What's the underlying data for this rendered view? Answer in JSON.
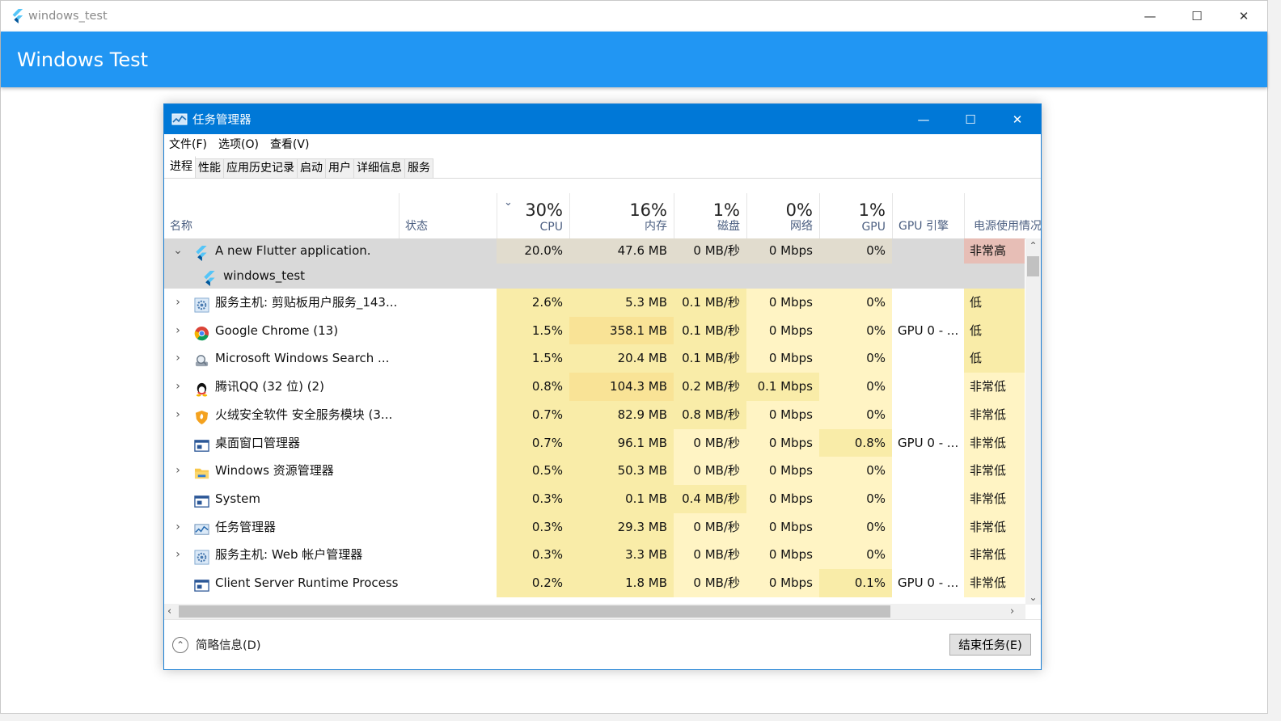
{
  "window": {
    "title": "windows_test",
    "controls": [
      "—",
      "☐",
      "✕"
    ]
  },
  "appbar": {
    "title": "Windows Test"
  },
  "taskmanager": {
    "title": "任务管理器",
    "controls": [
      "—",
      "☐",
      "✕"
    ],
    "menu": [
      "文件(F)",
      "选项(O)",
      "查看(V)"
    ],
    "tabs": [
      "进程",
      "性能",
      "应用历史记录",
      "启动",
      "用户",
      "详细信息",
      "服务"
    ],
    "header": {
      "name": "名称",
      "status": "状态",
      "cpu_pct": "30%",
      "cpu": "CPU",
      "mem_pct": "16%",
      "mem": "内存",
      "disk_pct": "1%",
      "disk": "磁盘",
      "net_pct": "0%",
      "net": "网络",
      "gpu_pct": "1%",
      "gpu": "GPU",
      "gpu_engine": "GPU 引擎",
      "power": "电源使用情况"
    },
    "rows": [
      {
        "name": "A new Flutter application.",
        "cpu": "20.0%",
        "mem": "47.6 MB",
        "disk": "0 MB/秒",
        "net": "0 Mbps",
        "gpu": "0%",
        "engine": "",
        "power": "非常高",
        "chevron": "⌄",
        "icon": "flutter-icon"
      },
      {
        "name": "windows_test",
        "cpu": "",
        "mem": "",
        "disk": "",
        "net": "",
        "gpu": "",
        "engine": "",
        "power": "",
        "chevron": "",
        "icon": "flutter-icon"
      },
      {
        "name": "服务主机: 剪贴板用户服务_143...",
        "cpu": "2.6%",
        "mem": "5.3 MB",
        "disk": "0.1 MB/秒",
        "net": "0 Mbps",
        "gpu": "0%",
        "engine": "",
        "power": "低",
        "chevron": "›",
        "icon": "gear-icon"
      },
      {
        "name": "Google Chrome (13)",
        "cpu": "1.5%",
        "mem": "358.1 MB",
        "disk": "0.1 MB/秒",
        "net": "0 Mbps",
        "gpu": "0%",
        "engine": "GPU 0 - ...",
        "power": "低",
        "chevron": "›",
        "icon": "chrome-icon"
      },
      {
        "name": "Microsoft Windows Search ...",
        "cpu": "1.5%",
        "mem": "20.4 MB",
        "disk": "0.1 MB/秒",
        "net": "0 Mbps",
        "gpu": "0%",
        "engine": "",
        "power": "低",
        "chevron": "›",
        "icon": "search-service-icon"
      },
      {
        "name": "腾讯QQ (32 位) (2)",
        "cpu": "0.8%",
        "mem": "104.3 MB",
        "disk": "0.2 MB/秒",
        "net": "0.1 Mbps",
        "gpu": "0%",
        "engine": "",
        "power": "非常低",
        "chevron": "›",
        "icon": "qq-icon"
      },
      {
        "name": "火绒安全软件 安全服务模块 (3...",
        "cpu": "0.7%",
        "mem": "82.9 MB",
        "disk": "0.8 MB/秒",
        "net": "0 Mbps",
        "gpu": "0%",
        "engine": "",
        "power": "非常低",
        "chevron": "›",
        "icon": "shield-icon"
      },
      {
        "name": "桌面窗口管理器",
        "cpu": "0.7%",
        "mem": "96.1 MB",
        "disk": "0 MB/秒",
        "net": "0 Mbps",
        "gpu": "0.8%",
        "engine": "GPU 0 - ...",
        "power": "非常低",
        "chevron": "",
        "icon": "window-icon"
      },
      {
        "name": "Windows 资源管理器",
        "cpu": "0.5%",
        "mem": "50.3 MB",
        "disk": "0 MB/秒",
        "net": "0 Mbps",
        "gpu": "0%",
        "engine": "",
        "power": "非常低",
        "chevron": "›",
        "icon": "folder-icon"
      },
      {
        "name": "System",
        "cpu": "0.3%",
        "mem": "0.1 MB",
        "disk": "0.4 MB/秒",
        "net": "0 Mbps",
        "gpu": "0%",
        "engine": "",
        "power": "非常低",
        "chevron": "",
        "icon": "window-icon"
      },
      {
        "name": "任务管理器",
        "cpu": "0.3%",
        "mem": "29.3 MB",
        "disk": "0 MB/秒",
        "net": "0 Mbps",
        "gpu": "0%",
        "engine": "",
        "power": "非常低",
        "chevron": "›",
        "icon": "taskmgr-icon"
      },
      {
        "name": "服务主机: Web 帐户管理器",
        "cpu": "0.3%",
        "mem": "3.3 MB",
        "disk": "0 MB/秒",
        "net": "0 Mbps",
        "gpu": "0%",
        "engine": "",
        "power": "非常低",
        "chevron": "›",
        "icon": "gear-icon"
      },
      {
        "name": "Client Server Runtime Process",
        "cpu": "0.2%",
        "mem": "1.8 MB",
        "disk": "0 MB/秒",
        "net": "0 Mbps",
        "gpu": "0.1%",
        "engine": "GPU 0 - ...",
        "power": "非常低",
        "chevron": "",
        "icon": "window-icon"
      }
    ],
    "footer": {
      "fewer": "简略信息(D)",
      "end_task": "结束任务(E)"
    },
    "colors": {
      "light": "#fff4c4",
      "mid": "#f9eca8",
      "strong": "#f9e396",
      "power_high": "#e7beb6",
      "selected": "#d9d9d9",
      "selected_gradient": "#e1dcce"
    }
  }
}
